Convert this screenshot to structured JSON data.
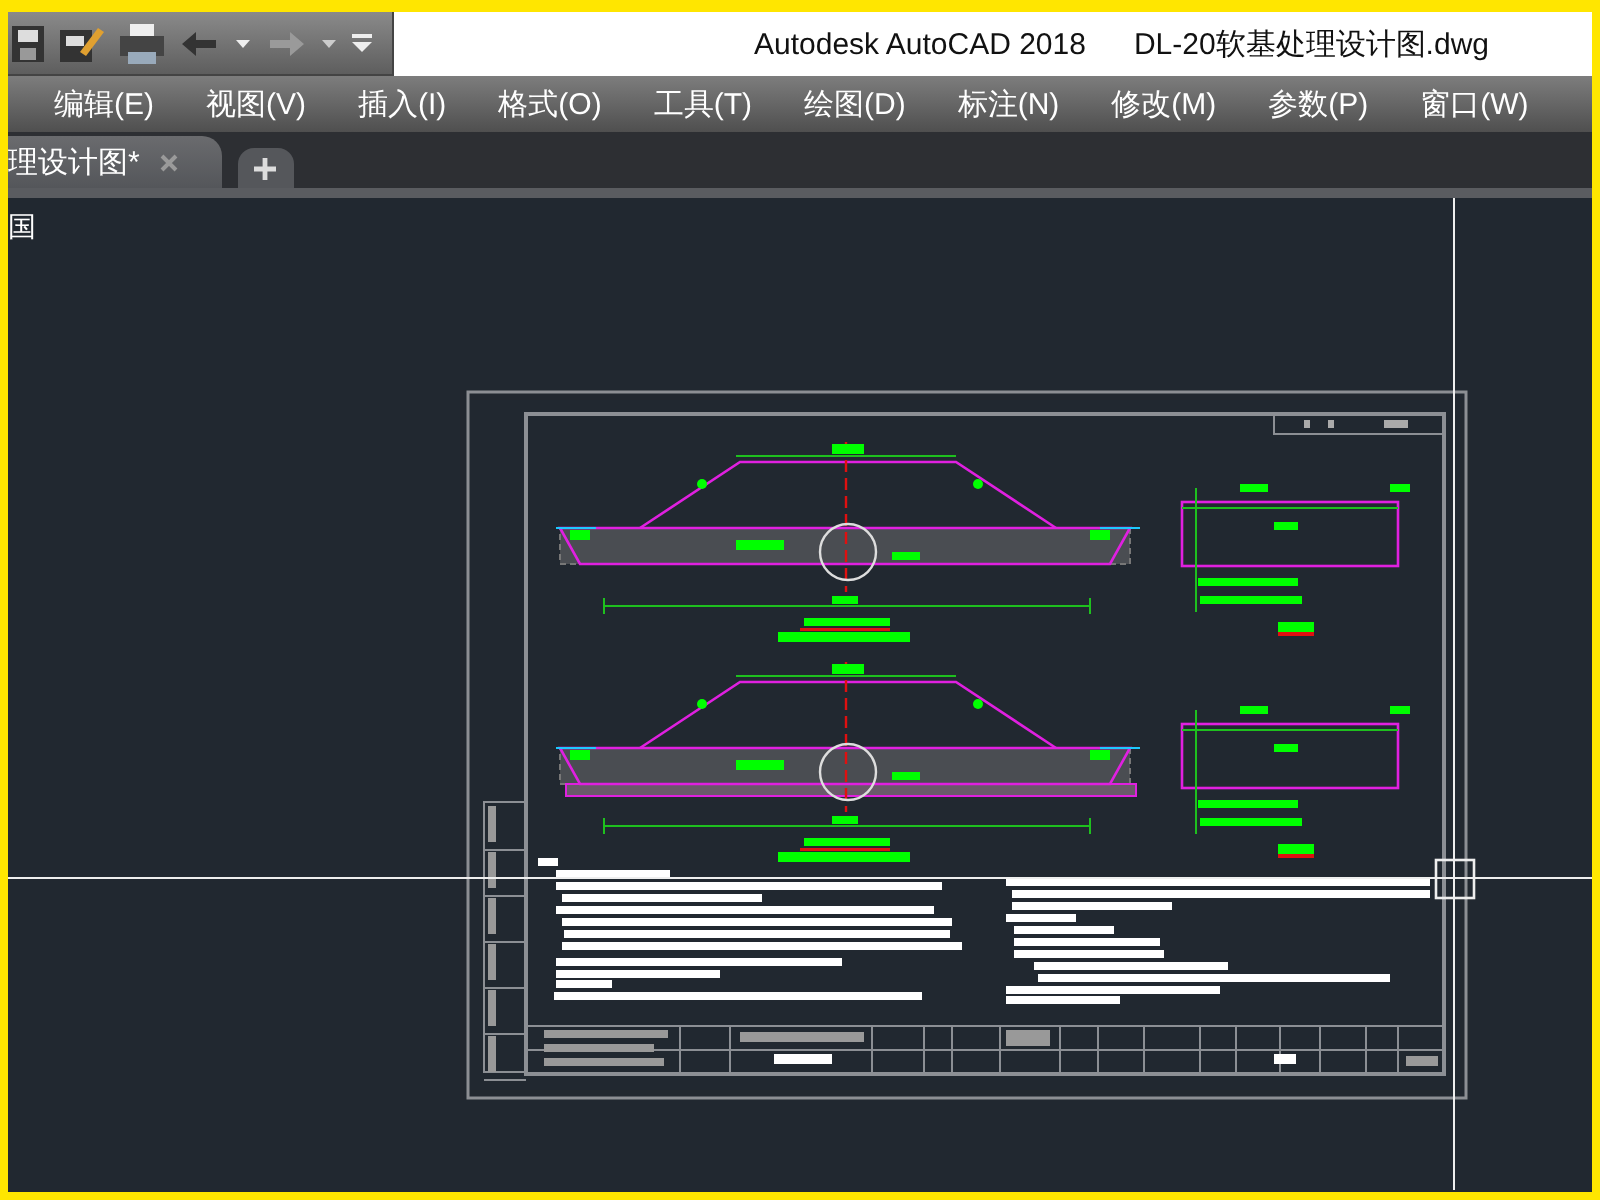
{
  "window": {
    "app_title": "Autodesk AutoCAD 2018",
    "file_title": "DL-20软基处理设计图.dwg"
  },
  "menu": [
    "编辑(E)",
    "视图(V)",
    "插入(I)",
    "格式(O)",
    "工具(T)",
    "绘图(D)",
    "标注(N)",
    "修改(M)",
    "参数(P)",
    "窗口(W)"
  ],
  "tabs": [
    {
      "label": "理设计图*",
      "selected": true
    }
  ],
  "viewport": {
    "label": "国"
  }
}
